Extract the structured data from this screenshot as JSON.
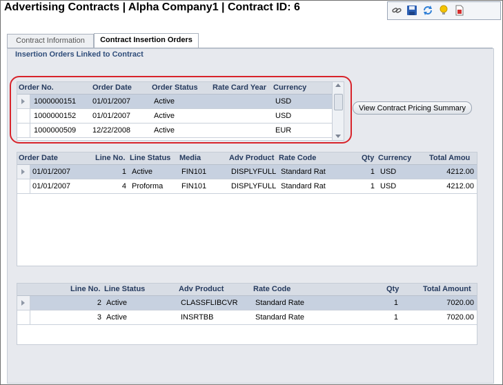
{
  "header": {
    "title": "Advertising Contracts  |  Alpha Company1 | Contract ID: 6"
  },
  "toolbar": {
    "icons": [
      "link-icon",
      "save-icon",
      "refresh-icon",
      "lightbulb-icon",
      "report-icon"
    ]
  },
  "tabs": [
    {
      "label": "Contract Information",
      "active": false
    },
    {
      "label": "Contract Insertion Orders",
      "active": true
    }
  ],
  "section": {
    "label": "Insertion Orders Linked to Contract"
  },
  "orders_grid": {
    "columns": [
      "Order No.",
      "Order Date",
      "Order Status",
      "Rate Card Year",
      "Currency"
    ],
    "rows": [
      {
        "order_no": "1000000151",
        "order_date": "01/01/2007",
        "status": "Active",
        "rate_card_year": "",
        "currency": "USD",
        "selected": true
      },
      {
        "order_no": "1000000152",
        "order_date": "01/01/2007",
        "status": "Active",
        "rate_card_year": "",
        "currency": "USD",
        "selected": false
      },
      {
        "order_no": "1000000509",
        "order_date": "12/22/2008",
        "status": "Active",
        "rate_card_year": "",
        "currency": "EUR",
        "selected": false
      }
    ]
  },
  "pricing_button": {
    "label": "View Contract Pricing Summary"
  },
  "lines_grid": {
    "columns": [
      "Order Date",
      "Line No.",
      "Line Status",
      "Media",
      "Adv Product",
      "Rate Code",
      "Qty",
      "Currency",
      "Total Amou"
    ],
    "rows": [
      {
        "order_date": "01/01/2007",
        "line_no": "1",
        "status": "Active",
        "media": "FIN101",
        "adv_product": "DISPLYFULL",
        "rate_code": "Standard Rat",
        "qty": "1",
        "currency": "USD",
        "total": "4212.00",
        "selected": true
      },
      {
        "order_date": "01/01/2007",
        "line_no": "4",
        "status": "Proforma",
        "media": "FIN101",
        "adv_product": "DISPLYFULL",
        "rate_code": "Standard Rat",
        "qty": "1",
        "currency": "USD",
        "total": "4212.00",
        "selected": false
      }
    ]
  },
  "detail_grid": {
    "columns": [
      "Line No.",
      "Line Status",
      "Adv Product",
      "Rate Code",
      "Qty",
      "Total Amount"
    ],
    "rows": [
      {
        "line_no": "2",
        "status": "Active",
        "adv_product": "CLASSFLIBCVR",
        "rate_code": "Standard Rate",
        "qty": "1",
        "total": "7020.00",
        "selected": true
      },
      {
        "line_no": "3",
        "status": "Active",
        "adv_product": "INSRTBB",
        "rate_code": "Standard Rate",
        "qty": "1",
        "total": "7020.00",
        "selected": false
      }
    ]
  },
  "colors": {
    "highlight": "#d8232a",
    "section_label": "#2f4d7a",
    "selected_row": "#c7d1e0"
  }
}
